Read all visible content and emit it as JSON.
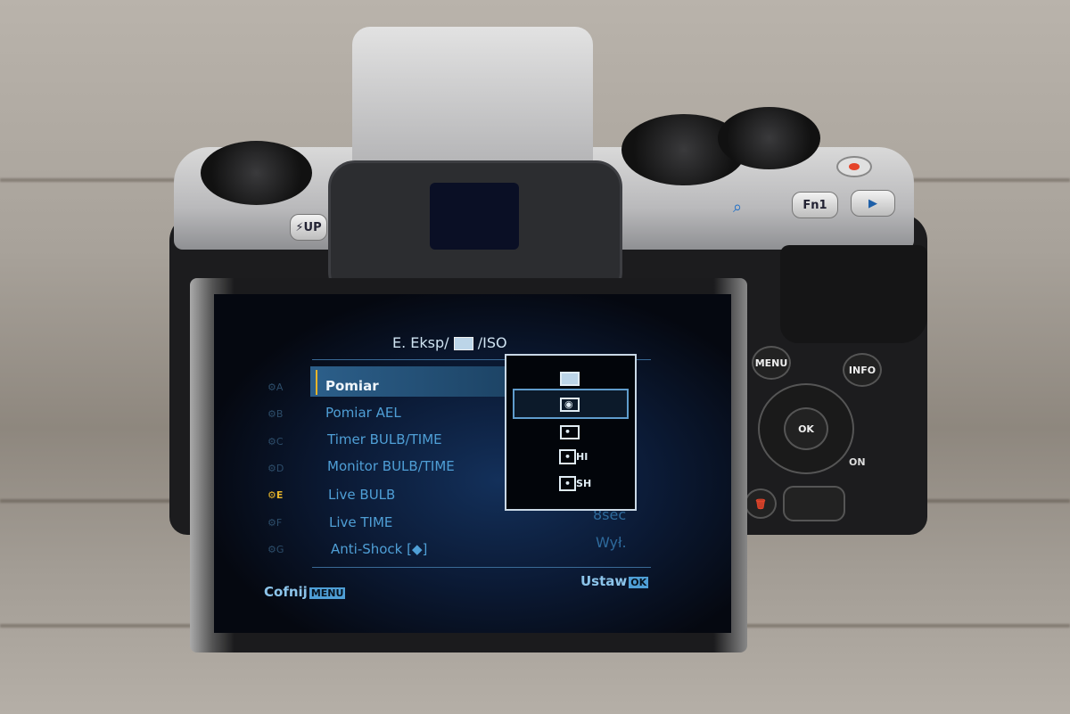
{
  "camera": {
    "buttons": {
      "menu": "MENU",
      "info": "INFO",
      "ok": "OK",
      "fn1": "Fn1",
      "flash": "⚡UP",
      "on": "ON"
    },
    "icons": [
      "play-icon",
      "magnify-icon",
      "mode-dial",
      "control-dial"
    ]
  },
  "screen": {
    "title_prefix": "E. Eksp/",
    "title_suffix": "/ISO",
    "categories": [
      "A",
      "B",
      "C",
      "D",
      "E",
      "F",
      "G"
    ],
    "active_category": "E",
    "items": [
      {
        "label": "Pomiar",
        "value": ""
      },
      {
        "label": "Pomiar AEL",
        "value": ""
      },
      {
        "label": "Timer BULB/TIME",
        "value": ""
      },
      {
        "label": "Monitor BULB/TIME",
        "value": ""
      },
      {
        "label": "Live BULB",
        "value": ""
      },
      {
        "label": "Live TIME",
        "value": "8sec"
      },
      {
        "label": "Anti-Shock [◆]",
        "value": "Wył."
      }
    ],
    "popup_options": [
      "ESP",
      "Center-weighted",
      "Spot",
      "HI",
      "SH"
    ],
    "popup_labels": {
      "hi": "HI",
      "sh": "SH"
    },
    "popup_selected": 1,
    "footer": {
      "back": "Cofnij",
      "back_key": "MENU",
      "set": "Ustaw",
      "set_key": "OK"
    },
    "accent": "#4f9fd6",
    "highlight": "#e8b52a"
  }
}
